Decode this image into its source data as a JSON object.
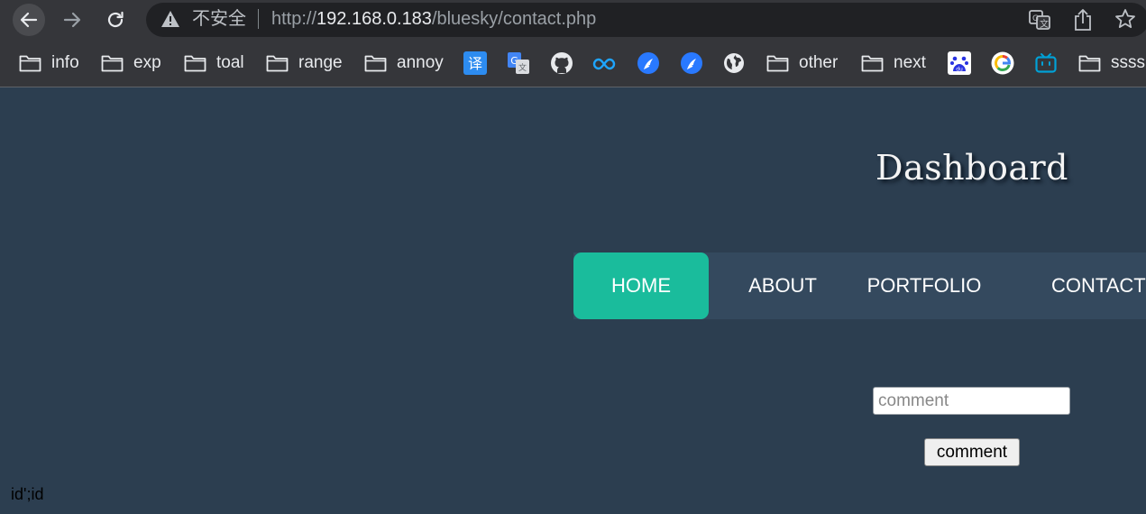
{
  "browser": {
    "insecure_label": "不安全",
    "url": {
      "scheme": "http://",
      "host": "192.168.0.183",
      "path": "/bluesky/contact.php"
    }
  },
  "bookmarks": {
    "folders": {
      "info": "info",
      "exp": "exp",
      "toal": "toal",
      "range": "range",
      "annoy": "annoy",
      "other": "other",
      "next": "next",
      "ssss": "ssss"
    },
    "icons": [
      "translate-yi-icon",
      "google-translate-icon",
      "github-icon",
      "cloud-icon",
      "feather-icon",
      "feather-icon",
      "globe-icon",
      "baidu-icon",
      "google-icon",
      "bilibili-icon"
    ]
  },
  "page": {
    "title": "Dashboard",
    "nav": {
      "home": "HOME",
      "about": "ABOUT",
      "portfolio": "PORTFOLIO",
      "contact": "CONTACT"
    },
    "form": {
      "comment_placeholder": "comment",
      "comment_value": "",
      "button_label": "comment"
    },
    "output": "id';id"
  },
  "colors": {
    "page_bg": "#2c3e50",
    "nav_bg": "#34495e",
    "nav_active": "#1abc9c"
  }
}
